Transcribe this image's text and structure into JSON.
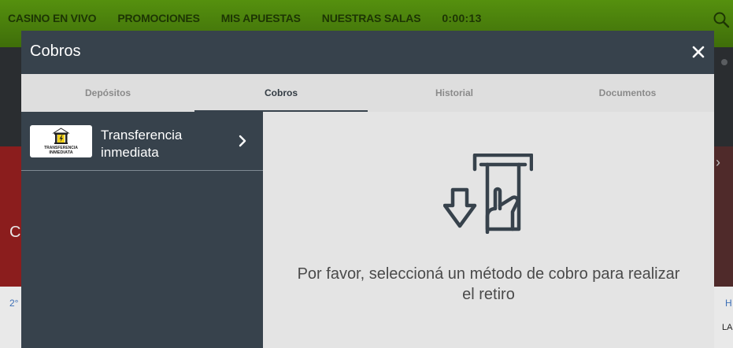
{
  "background": {
    "nav_items": [
      "CASINO EN VIVO",
      "PROMOCIONES",
      "MIS APUESTAS",
      "NUESTRAS SALAS"
    ],
    "timer": "0:00:13",
    "left_letter": "C",
    "left_number": "2°",
    "right_letter": "H",
    "right_text": "LA"
  },
  "modal": {
    "title": "Cobros",
    "tabs": [
      {
        "label": "Depósitos",
        "active": false
      },
      {
        "label": "Cobros",
        "active": true
      },
      {
        "label": "Historial",
        "active": false
      },
      {
        "label": "Documentos",
        "active": false
      }
    ],
    "methods": [
      {
        "label": "Transferencia inmediata",
        "logo_text": [
          "TRANSFERENCIA",
          "INMEDIATA"
        ],
        "icon": "chevron-right-icon"
      }
    ],
    "message": "Por favor, seleccioná un método de cobro para realizar el retiro",
    "illustration_icon": "atm-withdrawal-icon"
  },
  "colors": {
    "nav_green": "#4a7d0c",
    "modal_header": "#37424c",
    "content_bg": "#e4e4e4",
    "logo_yellow": "#f3d21c"
  }
}
